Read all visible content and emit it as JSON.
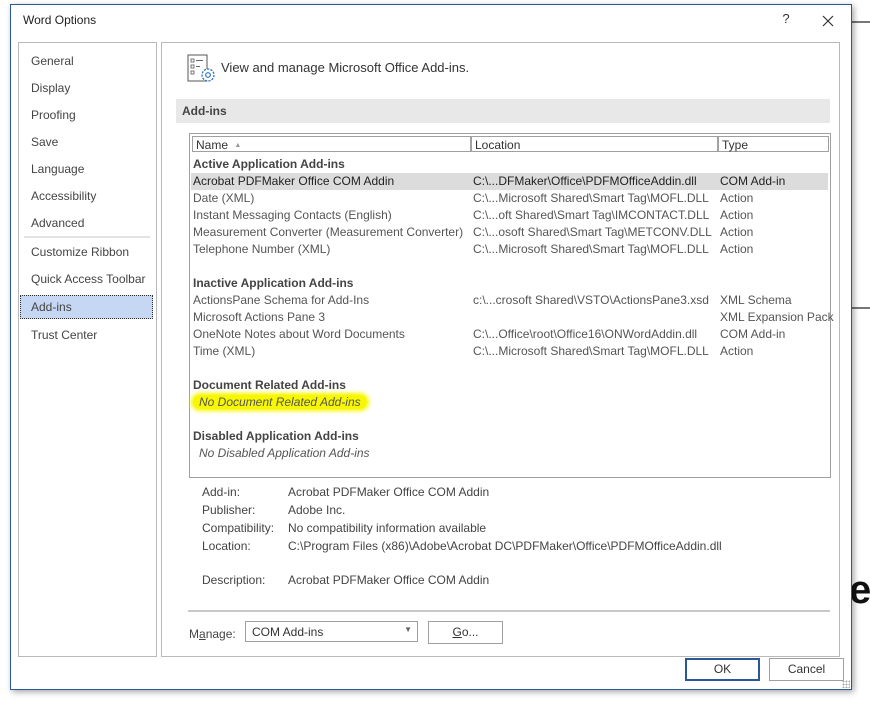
{
  "window": {
    "title": "Word Options",
    "help_label": "?",
    "close_label": "✕"
  },
  "sidebar": {
    "items": [
      {
        "label": "General"
      },
      {
        "label": "Display"
      },
      {
        "label": "Proofing"
      },
      {
        "label": "Save"
      },
      {
        "label": "Language"
      },
      {
        "label": "Accessibility"
      },
      {
        "label": "Advanced"
      },
      {
        "label": "Customize Ribbon"
      },
      {
        "label": "Quick Access Toolbar"
      },
      {
        "label": "Add-ins",
        "selected": true
      },
      {
        "label": "Trust Center"
      }
    ]
  },
  "header": {
    "icon": "addins-gear-icon",
    "text": "View and manage Microsoft Office Add-ins."
  },
  "section": {
    "title": "Add-ins"
  },
  "table": {
    "columns": [
      {
        "label": "Name",
        "sort": "ascending"
      },
      {
        "label": "Location"
      },
      {
        "label": "Type"
      }
    ],
    "sort_indicator": "▲",
    "groups": [
      {
        "title": "Active Application Add-ins",
        "rows": [
          {
            "name": "Acrobat PDFMaker Office COM Addin",
            "location": "C:\\...DFMaker\\Office\\PDFMOfficeAddin.dll",
            "type": "COM Add-in",
            "selected": true
          },
          {
            "name": "Date (XML)",
            "location": "C:\\...Microsoft Shared\\Smart Tag\\MOFL.DLL",
            "type": "Action"
          },
          {
            "name": "Instant Messaging Contacts (English)",
            "location": "C:\\...oft Shared\\Smart Tag\\IMCONTACT.DLL",
            "type": "Action"
          },
          {
            "name": "Measurement Converter (Measurement Converter)",
            "location": "C:\\...osoft Shared\\Smart Tag\\METCONV.DLL",
            "type": "Action"
          },
          {
            "name": "Telephone Number (XML)",
            "location": "C:\\...Microsoft Shared\\Smart Tag\\MOFL.DLL",
            "type": "Action"
          }
        ]
      },
      {
        "title": "Inactive Application Add-ins",
        "rows": [
          {
            "name": "ActionsPane Schema for Add-Ins",
            "location": "c:\\...crosoft Shared\\VSTO\\ActionsPane3.xsd",
            "type": "XML Schema"
          },
          {
            "name": "Microsoft Actions Pane 3",
            "location": "",
            "type": "XML Expansion Pack"
          },
          {
            "name": "OneNote Notes about Word Documents",
            "location": "C:\\...Office\\root\\Office16\\ONWordAddin.dll",
            "type": "COM Add-in"
          },
          {
            "name": "Time (XML)",
            "location": "C:\\...Microsoft Shared\\Smart Tag\\MOFL.DLL",
            "type": "Action"
          }
        ]
      },
      {
        "title": "Document Related Add-ins",
        "empty_text": "No Document Related Add-ins",
        "highlighted": true
      },
      {
        "title": "Disabled Application Add-ins",
        "empty_text": "No Disabled Application Add-ins"
      }
    ]
  },
  "details": {
    "addin_label": "Add-in:",
    "addin_value": "Acrobat PDFMaker Office COM Addin",
    "publisher_label": "Publisher:",
    "publisher_value": "Adobe Inc.",
    "compat_label": "Compatibility:",
    "compat_value": "No compatibility information available",
    "location_label": "Location:",
    "location_value": "C:\\Program Files (x86)\\Adobe\\Acrobat DC\\PDFMaker\\Office\\PDFMOfficeAddin.dll",
    "description_label": "Description:",
    "description_value": "Acrobat PDFMaker Office COM Addin"
  },
  "manage": {
    "label_pre": "M",
    "label_mnemonic": "a",
    "label_post": "nage:",
    "selected": "COM Add-ins",
    "go_mnemonic": "G",
    "go_rest": "o..."
  },
  "footer": {
    "ok_label": "OK",
    "cancel_label": "Cancel"
  },
  "background": {
    "letter": "e"
  },
  "colors": {
    "accent": "#2b5797",
    "selected_nav": "#c5d7f2",
    "highlight": "#f7f700"
  }
}
